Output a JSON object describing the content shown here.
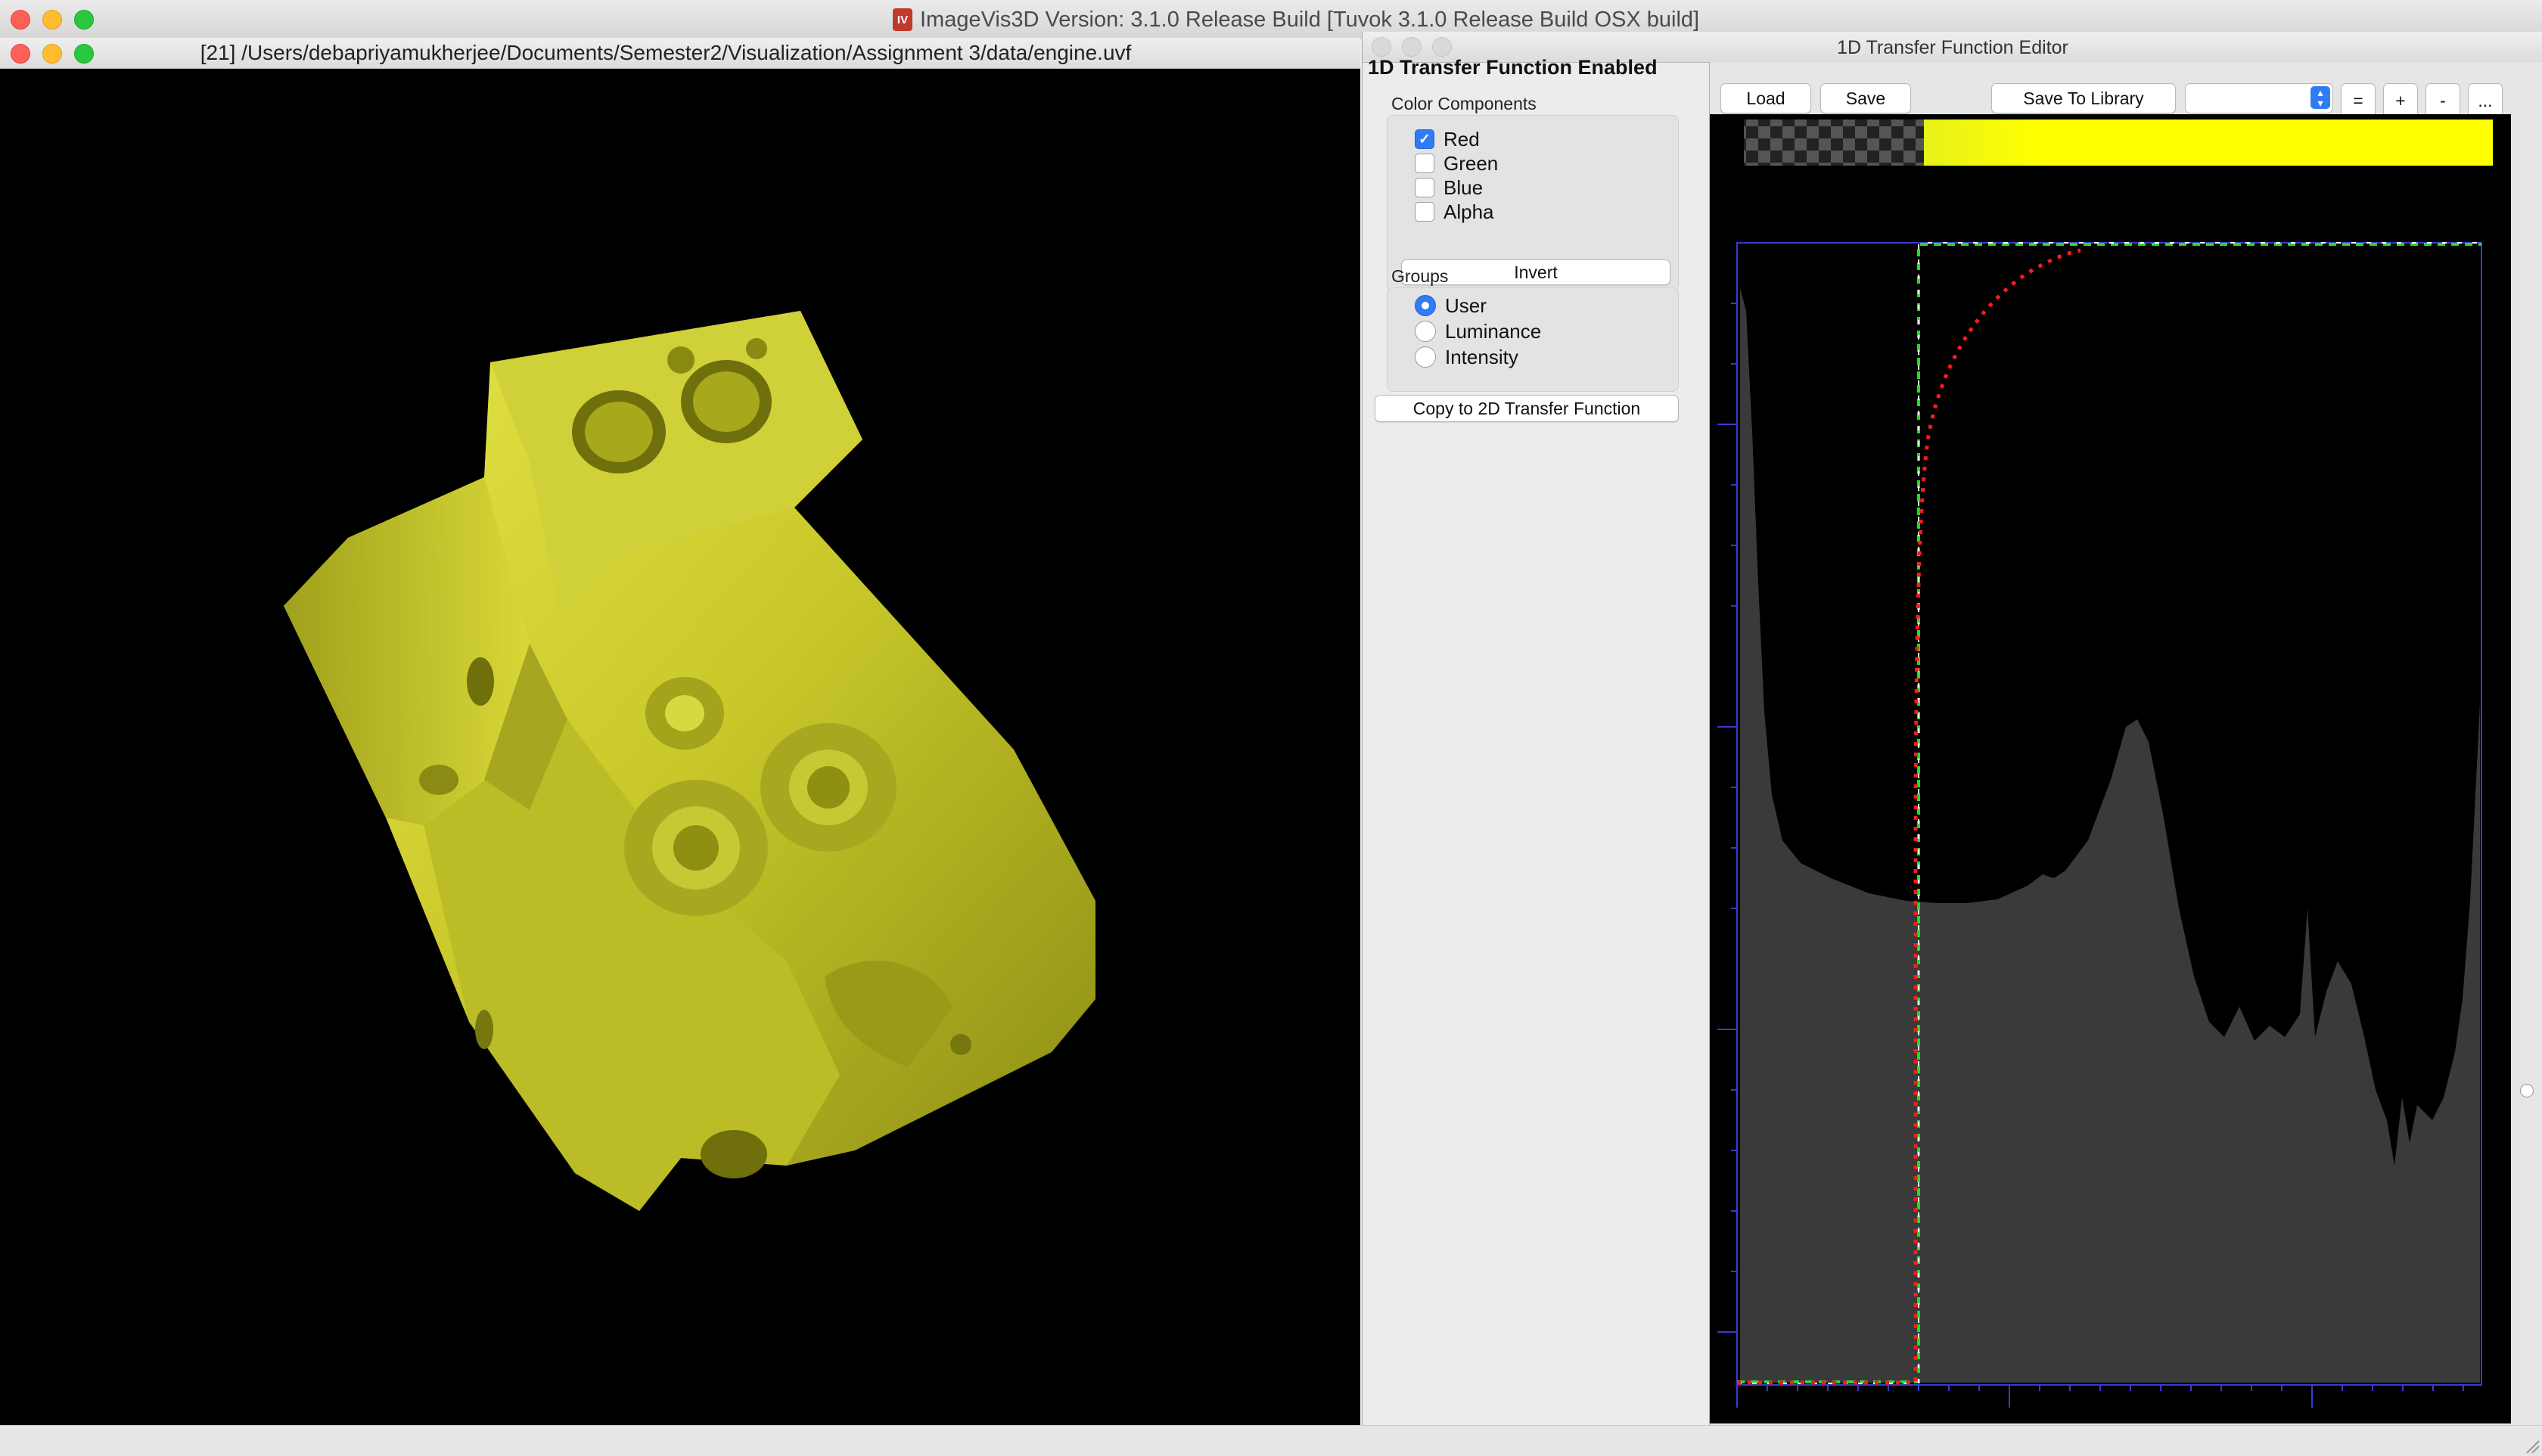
{
  "app": {
    "title": "ImageVis3D Version: 3.1.0 Release Build [Tuvok 3.1.0 Release Build OSX build]",
    "icon": "imagevis3d-app-icon"
  },
  "render_window": {
    "title": "[21] /Users/debapriyamukherjee/Documents/Semester2/Visualization/Assignment 3/data/engine.uvf",
    "volume_color": "#d6d62a"
  },
  "editor": {
    "title": "1D Transfer Function Editor",
    "enabled_label": "1D Transfer Function Enabled",
    "color_components": {
      "title": "Color Components",
      "items": [
        {
          "label": "Red",
          "checked": true
        },
        {
          "label": "Green",
          "checked": false
        },
        {
          "label": "Blue",
          "checked": false
        },
        {
          "label": "Alpha",
          "checked": false
        }
      ],
      "invert_label": "Invert"
    },
    "groups": {
      "title": "Groups",
      "items": [
        {
          "label": "User",
          "selected": true
        },
        {
          "label": "Luminance",
          "selected": false
        },
        {
          "label": "Intensity",
          "selected": false
        }
      ]
    },
    "copy_label": "Copy to 2D Transfer Function",
    "toolbar": {
      "load_label": "Load",
      "save_label": "Save",
      "save_library_label": "Save To Library",
      "library_value": "",
      "equal_label": "=",
      "plus_label": "+",
      "minus_label": "-",
      "more_label": "..."
    },
    "colors": {
      "tf_color": "#ffff00",
      "histogram": "#3a3a3a",
      "accent": "#2f7cf6",
      "red_curve": "#ff1a1a",
      "green_curve": "#22dd22",
      "axis": "#3a3ad0"
    }
  }
}
